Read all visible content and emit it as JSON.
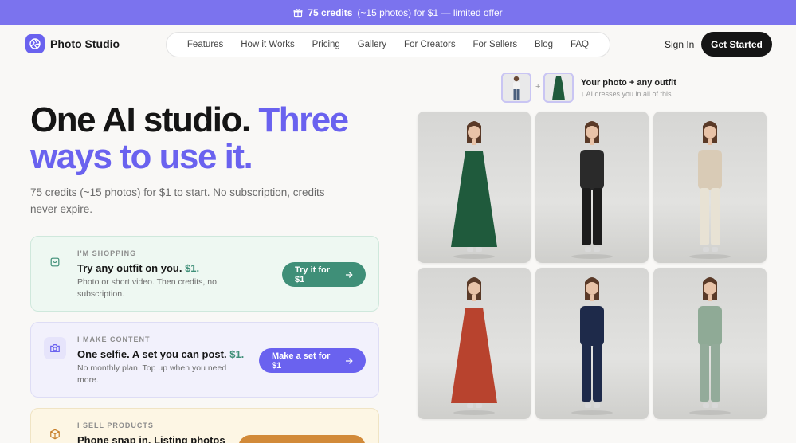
{
  "promo": {
    "strong": "75 credits",
    "rest": "(~15 photos) for $1 — limited offer",
    "icon": "gift-icon"
  },
  "brand": {
    "name": "Photo Studio",
    "icon": "aperture-icon"
  },
  "nav": {
    "items": [
      "Features",
      "How it Works",
      "Pricing",
      "Gallery",
      "For Creators",
      "For Sellers",
      "Blog",
      "FAQ"
    ],
    "sign_in": "Sign In",
    "cta": "Get Started"
  },
  "hero": {
    "title_main": "One AI studio.",
    "title_accent": "Three ways to use it.",
    "subtitle": "75 credits (~15 photos) for $1 to start. No subscription, credits never expire."
  },
  "cards": [
    {
      "eyebrow": "I'M SHOPPING",
      "title": "Try any outfit on you.",
      "price": "$1.",
      "desc": "Photo or short video. Then credits, no subscription.",
      "cta": "Try it for $1",
      "icon": "shopping-bag-icon",
      "color": "#3f8f78"
    },
    {
      "eyebrow": "I MAKE CONTENT",
      "title": "One selfie. A set you can post.",
      "price": "$1.",
      "desc": "No monthly plan. Top up when you need more.",
      "cta": "Make a set for $1",
      "icon": "camera-icon",
      "color": "#6a62ef"
    },
    {
      "eyebrow": "I SELL PRODUCTS",
      "title": "Phone snap in. Listing photos",
      "price": "",
      "desc": "",
      "cta": "",
      "icon": "box-icon",
      "color": "#d28a39"
    }
  ],
  "combo": {
    "title": "Your photo + any outfit",
    "subtitle": "↓ AI dresses you in all of this",
    "plus": "+"
  },
  "gallery": [
    {
      "name": "green-slip-dress",
      "top": "#1f5a3c",
      "bottom": "#1f5a3c",
      "dress": true
    },
    {
      "name": "leather-jacket-jeans",
      "top": "#2a2a2a",
      "bottom": "#1c1c1c",
      "dress": false
    },
    {
      "name": "beige-knit-set",
      "top": "#d9cbb6",
      "bottom": "#e8e2d4",
      "dress": false
    },
    {
      "name": "red-floral-dress",
      "top": "#b8432e",
      "bottom": "#b8432e",
      "dress": true
    },
    {
      "name": "navy-suit",
      "top": "#1e2a4a",
      "bottom": "#1e2a4a",
      "dress": false
    },
    {
      "name": "sage-activewear",
      "top": "#8faa96",
      "bottom": "#93ab9a",
      "dress": false
    }
  ]
}
